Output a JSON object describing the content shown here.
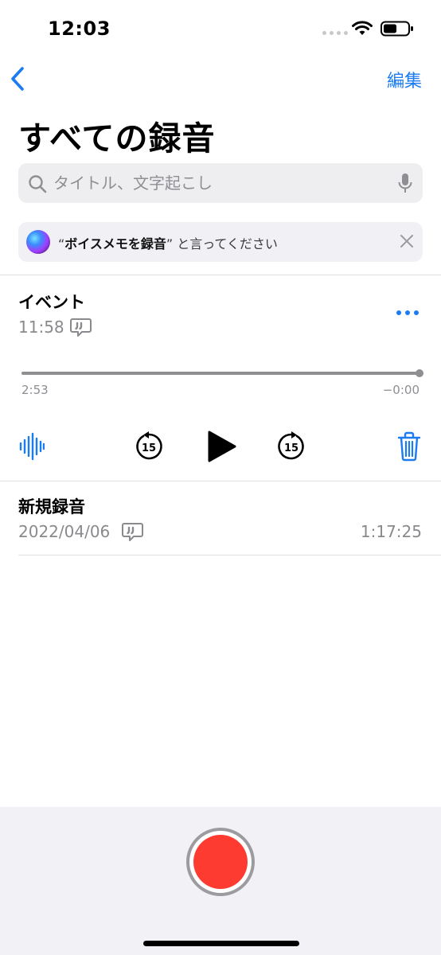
{
  "status": {
    "time": "12:03"
  },
  "nav": {
    "edit_label": "編集"
  },
  "page": {
    "title": "すべての録音"
  },
  "search": {
    "placeholder": "タイトル、文字起こし"
  },
  "siri_tip": {
    "quote_open": "“",
    "phrase": "ボイスメモを録音",
    "quote_close": "”",
    "rest": " と言ってください"
  },
  "recordings": [
    {
      "name": "イベント",
      "date": "11:58",
      "elapsed": "2:53",
      "remaining": "−0:00",
      "skip": "15",
      "progress": 1.0
    },
    {
      "name": "新規録音",
      "date": "2022/04/06",
      "duration": "1:17:25"
    }
  ],
  "colors": {
    "accent": "#1a7cf0",
    "record": "#fe3b30"
  }
}
